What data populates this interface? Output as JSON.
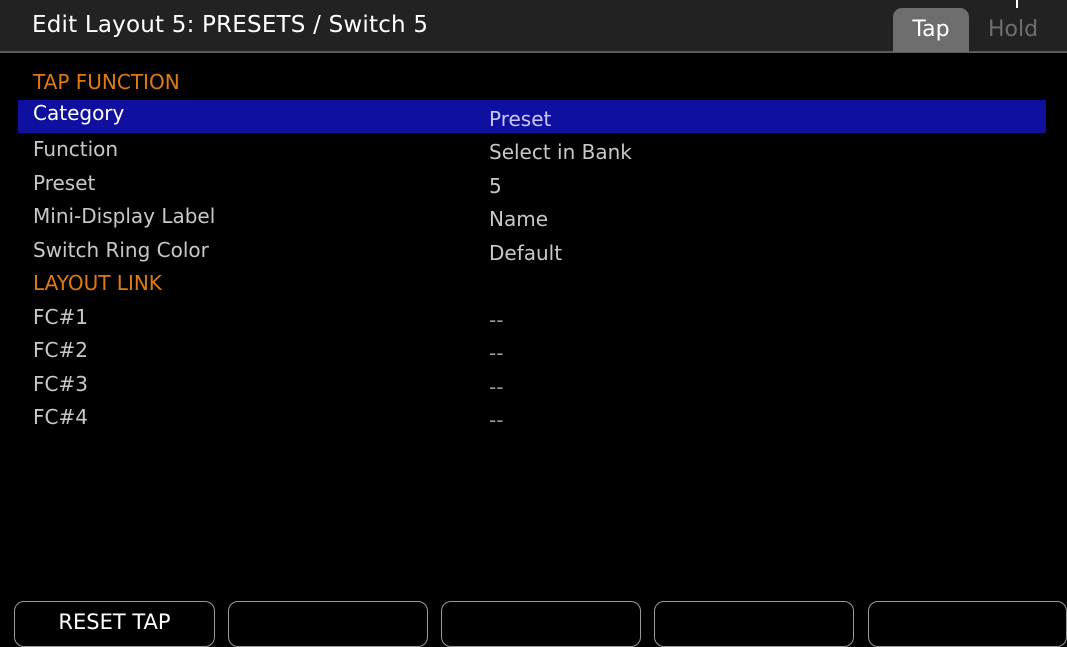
{
  "header": {
    "title": "Edit Layout 5: PRESETS / Switch 5",
    "tabs": [
      {
        "label": "Tap",
        "active": true
      },
      {
        "label": "Hold",
        "active": false
      }
    ]
  },
  "rows": [
    {
      "type": "section",
      "label": "TAP FUNCTION",
      "value": ""
    },
    {
      "type": "item",
      "label": "Category",
      "value": "Preset",
      "selected": true
    },
    {
      "type": "item",
      "label": "Function",
      "value": "Select in Bank"
    },
    {
      "type": "item",
      "label": "Preset",
      "value": "5"
    },
    {
      "type": "item",
      "label": "Mini-Display Label",
      "value": "Name"
    },
    {
      "type": "item",
      "label": "Switch Ring Color",
      "value": "Default"
    },
    {
      "type": "section",
      "label": "LAYOUT LINK",
      "value": ""
    },
    {
      "type": "item",
      "label": "FC#1",
      "value": "--"
    },
    {
      "type": "item",
      "label": "FC#2",
      "value": "--"
    },
    {
      "type": "item",
      "label": "FC#3",
      "value": "--"
    },
    {
      "type": "item",
      "label": "FC#4",
      "value": "--"
    }
  ],
  "softkeys": [
    "RESET TAP",
    "",
    "",
    "",
    ""
  ],
  "colors": {
    "section_label": "#e07a10",
    "selection_bg": "#0f10a0",
    "active_tab_bg": "#6e6e6e"
  }
}
